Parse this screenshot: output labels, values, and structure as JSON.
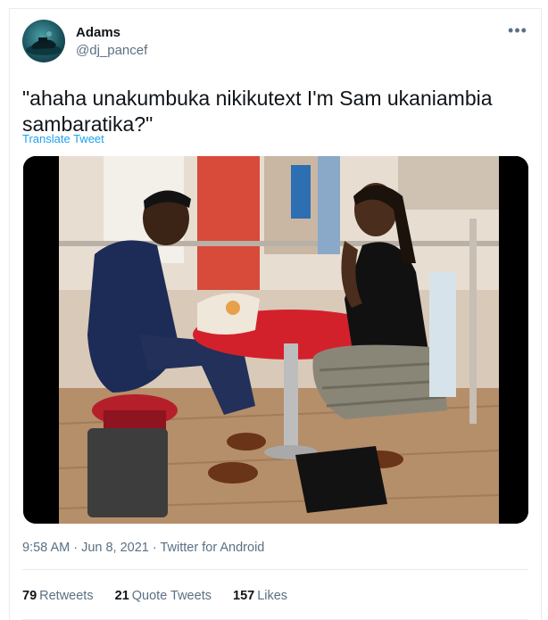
{
  "tweet": {
    "author_name": "Adams",
    "author_handle": "@dj_pancef",
    "more_icon": "more-horizontal-icon",
    "text": "\"ahaha unakumbuka nikikutext I'm Sam ukaniambia sambaratika?\"",
    "translate_label": "Translate Tweet",
    "timestamp": "9:58 AM · Jun 8, 2021 · Twitter for Android"
  },
  "stats": {
    "retweets_count": "79",
    "retweets_label": "Retweets",
    "quote_count": "21",
    "quote_label": "Quote Tweets",
    "likes_count": "157",
    "likes_label": "Likes"
  },
  "colors": {
    "link_blue": "#1da1f2",
    "secondary_text": "#5b7083",
    "border": "#e6ecf0"
  }
}
